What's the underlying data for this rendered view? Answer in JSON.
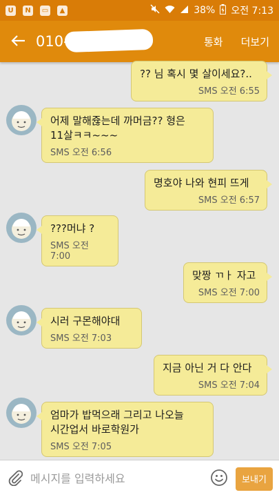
{
  "status_bar": {
    "battery": "38%",
    "time": "오전 7:13",
    "icons": [
      "u-app-icon",
      "n-app-icon",
      "gallery-icon",
      "image-icon",
      "mute-icon",
      "wifi-icon",
      "signal-icon",
      "battery-icon"
    ]
  },
  "header": {
    "contact": "010-",
    "call_label": "통화",
    "more_label": "더보기"
  },
  "messages": [
    {
      "dir": "out",
      "text": "?? 님 혹시 몇 살이세요?..",
      "time": "SMS 오전 6:55"
    },
    {
      "dir": "in",
      "text": "어제 말해쥲는데 까머금??  형은\n11살ㅋㅋ~~~",
      "time": "SMS 오전 6:56"
    },
    {
      "dir": "out",
      "text": "명호야 나와 현피 뜨게",
      "time": "SMS 오전 6:57"
    },
    {
      "dir": "in",
      "text": "???머냐 ?",
      "time": "SMS 오전 7:00"
    },
    {
      "dir": "out",
      "text": "맞짱 ㄲㅏ 자고",
      "time": "SMS 오전 7:00"
    },
    {
      "dir": "in",
      "text": "시러 구몬해야대",
      "time": "SMS 오전 7:03"
    },
    {
      "dir": "out",
      "text": "지금 아닌 거 다 안다",
      "time": "SMS 오전 7:04"
    },
    {
      "dir": "in",
      "text": "엄마가 밥먹으래 그리고 나오늘\n시간업서 바로학원가",
      "time": "SMS 오전 7:05"
    }
  ],
  "composer": {
    "placeholder": "메시지를 입력하세요",
    "value": "",
    "send_label": "보내기"
  },
  "colors": {
    "accent": "#e08a0c",
    "status_bar": "#d97c07",
    "bubble": "#f5eb98",
    "background": "#e6e6e6",
    "avatar": "#9bb7c4",
    "send_button": "#e9a440"
  }
}
